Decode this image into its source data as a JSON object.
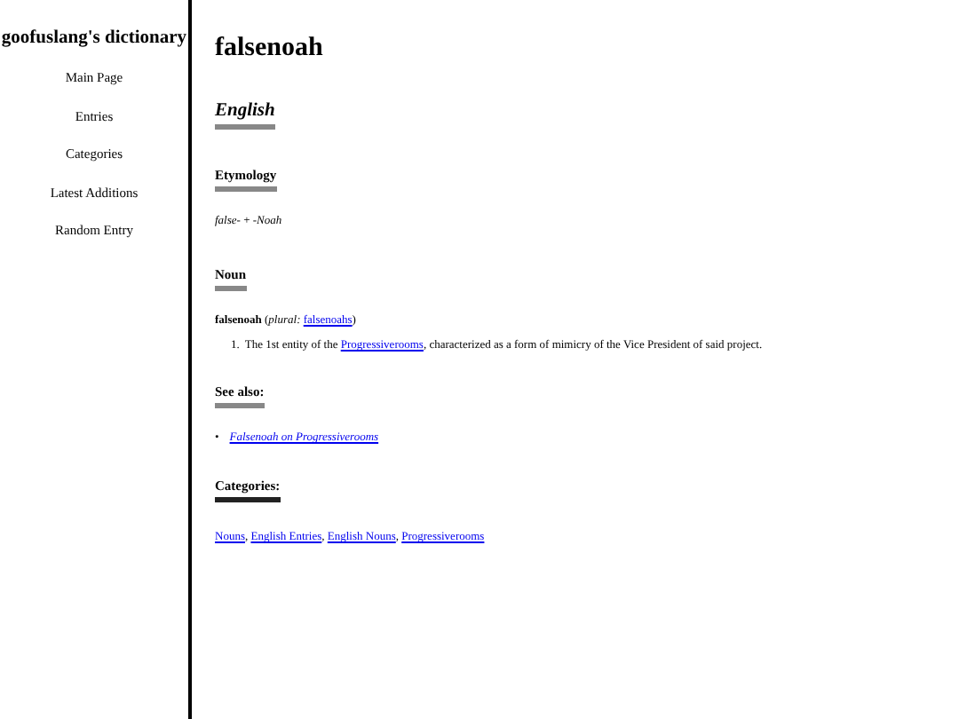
{
  "sidebar": {
    "title": "goofuslang's dictionary",
    "items": [
      "Main Page",
      "Entries",
      "Categories",
      "Latest Additions",
      "Random Entry"
    ]
  },
  "page": {
    "title": "falsenoah",
    "language": "English",
    "etymology": {
      "heading": "Etymology",
      "text": "*false-* + *-Noah*"
    },
    "noun": {
      "heading": "Noun",
      "headword": "falsenoah",
      "open_paren": "(",
      "plural_label": "plural:",
      "plural_link": "falsenoahs",
      "close_paren": ")",
      "definitions": [
        {
          "number": "1.",
          "before": "The 1st entity of the ",
          "link": "Progressiverooms",
          "after": ", characterized as a form of mimicry of the Vice President of said project."
        }
      ]
    },
    "see_also": {
      "heading": "See also:",
      "items": [
        {
          "bullet": "•",
          "link": "Falsenoah on Progressiverooms"
        }
      ]
    },
    "categories": {
      "heading": "Categories:",
      "separator": ",",
      "links": [
        "Nouns",
        "English Entries",
        "English Nouns",
        "Progressiverooms"
      ]
    }
  }
}
